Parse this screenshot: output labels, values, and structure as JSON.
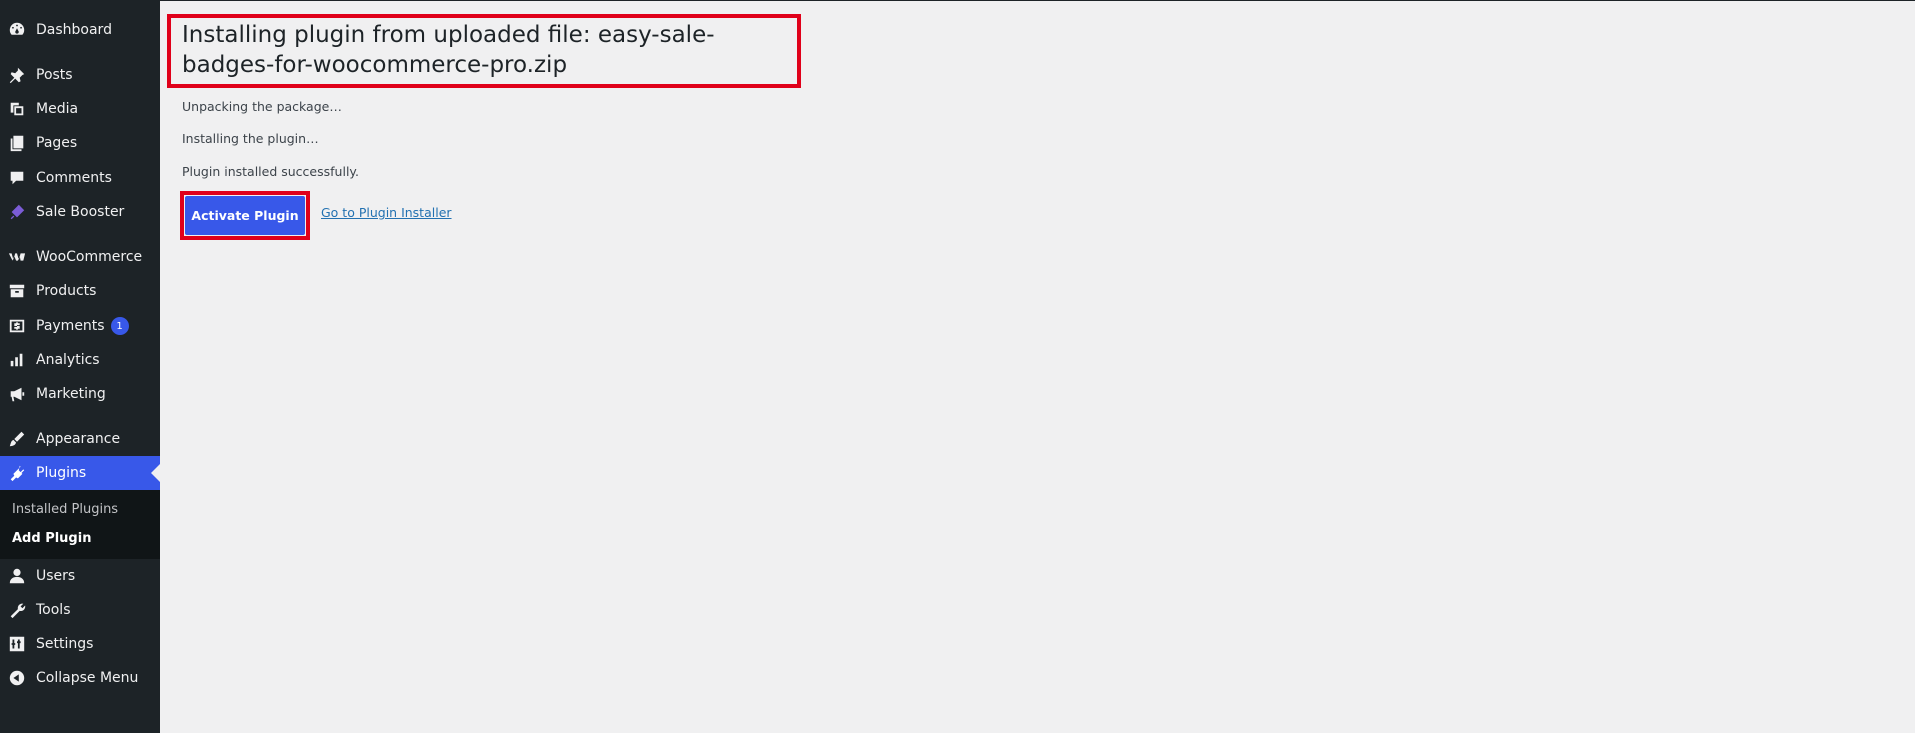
{
  "sidebar": {
    "items": [
      {
        "label": "Dashboard",
        "icon": "dashboard-icon"
      },
      {
        "label": "Posts",
        "icon": "pin-icon"
      },
      {
        "label": "Media",
        "icon": "media-icon"
      },
      {
        "label": "Pages",
        "icon": "pages-icon"
      },
      {
        "label": "Comments",
        "icon": "comment-icon"
      },
      {
        "label": "Sale Booster",
        "icon": "sale-booster-icon"
      },
      {
        "label": "WooCommerce",
        "icon": "woo-icon"
      },
      {
        "label": "Products",
        "icon": "archive-icon"
      },
      {
        "label": "Payments",
        "icon": "dollar-icon",
        "badge": "1"
      },
      {
        "label": "Analytics",
        "icon": "bar-chart-icon"
      },
      {
        "label": "Marketing",
        "icon": "megaphone-icon"
      },
      {
        "label": "Appearance",
        "icon": "brush-icon"
      },
      {
        "label": "Plugins",
        "icon": "plug-icon"
      },
      {
        "label": "Users",
        "icon": "user-icon"
      },
      {
        "label": "Tools",
        "icon": "wrench-icon"
      },
      {
        "label": "Settings",
        "icon": "sliders-icon"
      },
      {
        "label": "Collapse Menu",
        "icon": "collapse-icon"
      }
    ],
    "submenu": {
      "installed_plugins": "Installed Plugins",
      "add_plugin": "Add Plugin"
    },
    "accent_color": "#3858e9"
  },
  "main": {
    "title": "Installing plugin from uploaded file: easy-sale-badges-for-woocommerce-pro.zip",
    "messages": [
      "Unpacking the package…",
      "Installing the plugin…",
      "Plugin installed successfully."
    ],
    "activate_label": "Activate Plugin",
    "installer_link": "Go to Plugin Installer",
    "highlight_color": "#e0001a"
  }
}
